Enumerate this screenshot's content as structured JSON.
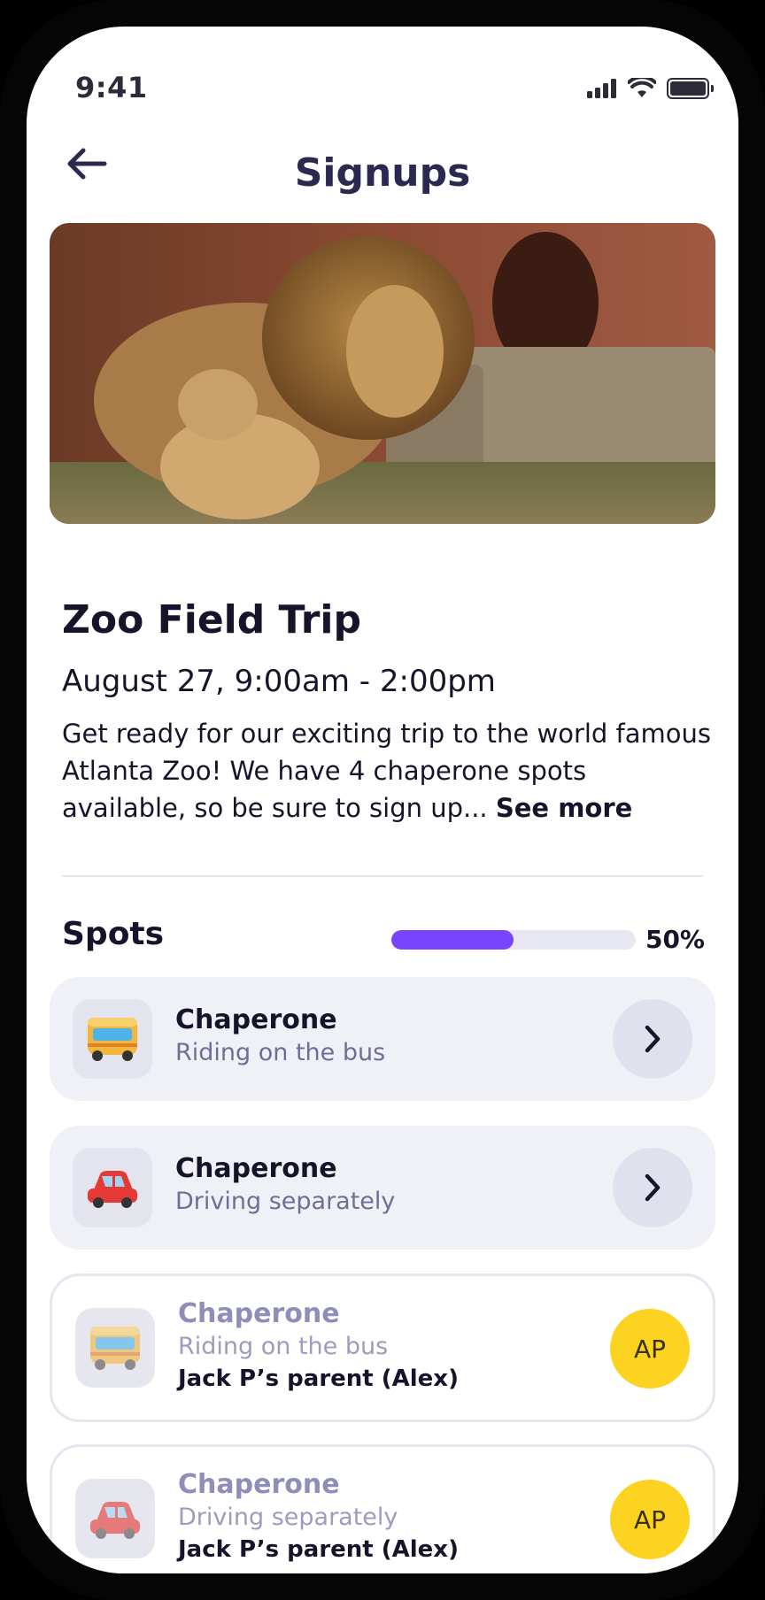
{
  "status_bar": {
    "time": "9:41"
  },
  "header": {
    "title": "Signups"
  },
  "event": {
    "title": "Zoo Field Trip",
    "date": "August 27, 9:00am - 2:00pm",
    "description": "Get ready for our exciting trip to the world famous Atlanta Zoo! We have 4 chaperone spots available, so be sure to sign up...",
    "see_more": "See more"
  },
  "spots": {
    "title": "Spots",
    "progress_label": "50%",
    "progress_value": 0.5,
    "accent_color": "#7a43ff",
    "items": [
      {
        "icon": "bus-icon",
        "title": "Chaperone",
        "subtitle": "Riding on the bus",
        "status": "open"
      },
      {
        "icon": "car-icon",
        "title": "Chaperone",
        "subtitle": "Driving separately",
        "status": "open"
      },
      {
        "icon": "bus-icon",
        "title": "Chaperone",
        "subtitle": "Riding on the bus",
        "assignee": "Jack P’s parent (Alex)",
        "avatar": "AP",
        "status": "filled"
      },
      {
        "icon": "car-icon",
        "title": "Chaperone",
        "subtitle": "Driving separately",
        "assignee": "Jack P’s parent (Alex)",
        "avatar": "AP",
        "status": "filled"
      }
    ]
  }
}
